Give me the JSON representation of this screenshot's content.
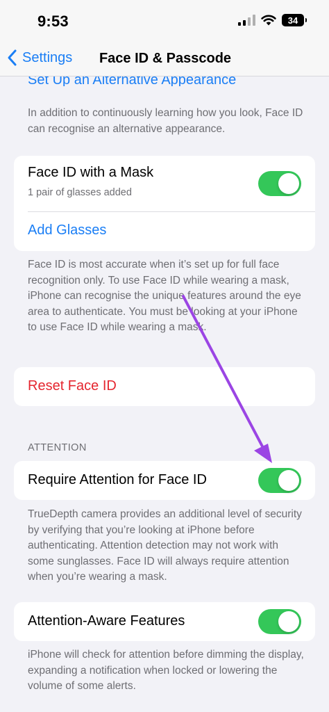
{
  "status_bar": {
    "time": "9:53",
    "battery": "34",
    "icons": [
      "cellular-signal-icon",
      "wifi-icon",
      "battery-icon"
    ]
  },
  "nav": {
    "back_label": "Settings",
    "title": "Face ID & Passcode",
    "back_icon": "chevron-left-icon"
  },
  "alt_appearance": {
    "link_label": "Set Up an Alternative Appearance",
    "footer": "In addition to continuously learning how you look, Face ID can recognise an alternative appearance."
  },
  "mask_group": {
    "title": "Face ID with a Mask",
    "subtitle": "1 pair of glasses added",
    "toggle_on": true,
    "add_glasses_label": "Add Glasses",
    "footer": "Face ID is most accurate when it’s set up for full face recognition only. To use Face ID while wearing a mask, iPhone can recognise the unique features around the eye area to authenticate. You must be looking at your iPhone to use Face ID while wearing a mask."
  },
  "reset": {
    "label": "Reset Face ID"
  },
  "attention": {
    "header": "ATTENTION",
    "require_title": "Require Attention for Face ID",
    "require_on": true,
    "require_footer": "TrueDepth camera provides an additional level of security by verifying that you’re looking at iPhone before authenticating. Attention detection may not work with some sunglasses. Face ID will always require attention when you’re wearing a mask.",
    "aware_title": "Attention-Aware Features",
    "aware_on": true,
    "aware_footer": "iPhone will check for attention before dimming the display, expanding a notification when locked or lowering the volume of some alerts."
  },
  "colors": {
    "accent": "#1a7ef5",
    "toggle_on": "#34c759",
    "destructive": "#e5262f",
    "annotation_arrow": "#9b45e4"
  }
}
